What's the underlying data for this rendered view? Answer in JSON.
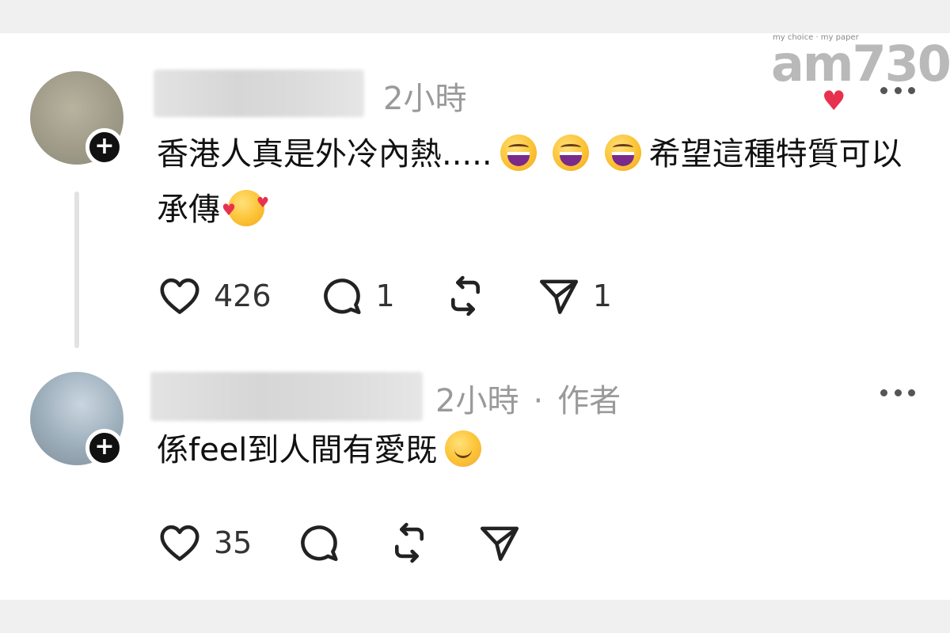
{
  "watermark": {
    "brand": "am730",
    "tagline": "my choice · my paper"
  },
  "comments": [
    {
      "time": "2小時",
      "author_tag": "",
      "text_parts": [
        "香港人真是外冷內熱.....",
        "希望這種特質可以承傳"
      ],
      "emojis": [
        "grinning-face-emoji",
        "grinning-face-emoji",
        "grinning-face-emoji",
        "smiling-face-with-hearts-emoji"
      ],
      "actions": {
        "likes": "426",
        "replies": "1",
        "reposts": "",
        "shares": "1"
      }
    },
    {
      "time": "2小時",
      "author_tag": "作者",
      "separator": "·",
      "text": "係feel到人間有愛既",
      "emojis": [
        "smiling-face-emoji"
      ],
      "actions": {
        "likes": "35",
        "replies": "",
        "reposts": "",
        "shares": ""
      }
    }
  ],
  "icons": {
    "like": "heart-icon",
    "reply": "speech-bubble-icon",
    "repost": "repost-icon",
    "share": "send-icon",
    "more": "more-dots-icon",
    "follow": "plus-icon"
  },
  "colors": {
    "meta": "#9a9a9a",
    "text": "#111111",
    "badge": "#111111"
  }
}
